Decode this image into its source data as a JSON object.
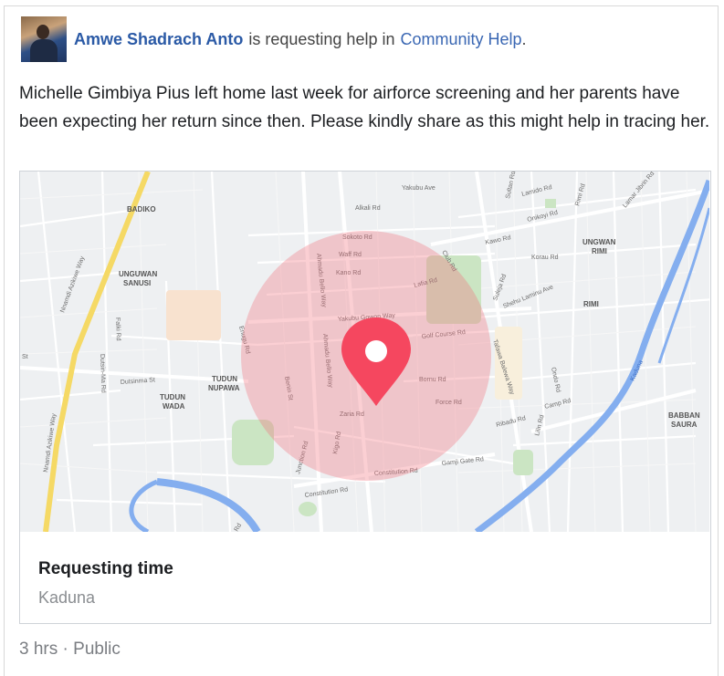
{
  "post": {
    "author": "Amwe Shadrach Anto",
    "verb": "is requesting help in",
    "group": "Community Help",
    "period": ".",
    "body": "Michelle Gimbiya Pius left home last week for airforce screening and her parents have been expecting her return since then. Please kindly share as this might help in tracing her."
  },
  "card": {
    "title": "Requesting time",
    "subtitle": "Kaduna"
  },
  "meta": {
    "time": "3 hrs",
    "separator": " · ",
    "privacy": "Public"
  },
  "map": {
    "districts": {
      "badiko": "BADIKO",
      "unguwan_sanusi_1": "UNGUWAN",
      "unguwan_sanusi_2": "SANUSI",
      "tudun_nupawa_1": "TUDUN",
      "tudun_nupawa_2": "NUPAWA",
      "tudun_wada_1": "TUDUN",
      "tudun_wada_2": "WADA",
      "unguwan_rimi_1": "UNGWAN",
      "unguwan_rimi_2": "RIMI",
      "rimi": "RIMI",
      "babban_saura_1": "BABBAN",
      "babban_saura_2": "SAURA"
    },
    "roads": {
      "yakubu_ave": "Yakubu Ave",
      "alkali_rd": "Alkali Rd",
      "sokoto_rd": "Sokoto Rd",
      "waff_rd": "Waff Rd",
      "kano_rd": "Kano Rd",
      "yakubu_gowon_way": "Yakubu Gowon Way",
      "golf_course_rd": "Golf Course Rd",
      "bornu_rd": "Bornu Rd",
      "force_rd": "Force Rd",
      "zaria_rd": "Zaria Rd",
      "constitution_rd": "Constitution Rd",
      "gamji_gate_rd": "Gamji Gate Rd",
      "junction_rd": "Junction Rd",
      "kigo_rd": "Kigo Rd",
      "ahmadu_bello_way": "Ahmadu Bello Way",
      "ahmadu_bello_way_2": "Ahmadu Bello Way",
      "enugu_rd": "Enugu Rd",
      "benin_st": "Benin St",
      "dutsinma_st": "Dutsinma St",
      "dutsin_ma_rd": "Dutsin-Ma Rd",
      "falki_rd": "Falki Rd",
      "nnamdi_azikiwe_way": "Nnamdi Azikiwe Way",
      "nnamdi_azikiwe_way_2": "Nnamdi Azikiwe Way",
      "tafawa_balewa_way": "Tafawa Balewa Way",
      "shehu_laminu_ave": "Shehu Laminu Ave",
      "kawo_rd": "Kawo Rd",
      "korau_rd": "Korau Rd",
      "lafia_rd": "Lafia Rd",
      "club_rd": "Club Rd",
      "camp_rd": "Camp Rd",
      "ribadu_rd": "Ribadu Rd",
      "lilin_rd": "Lilin Rd",
      "ondo_rd": "Ondo Rd",
      "suleja_rd": "Suleja Rd",
      "sultan_rd": "Sultan Rd",
      "lamido_rd": "Lamido Rd",
      "onikoyi_rd": "Onikoyi Rd",
      "rimi_rd": "Rimi Rd",
      "lamar_rd": "Lamar Jibrin Rd",
      "kaduna_river": "Kaduna",
      "st": "St",
      "rd_fragment": "Rd"
    }
  }
}
